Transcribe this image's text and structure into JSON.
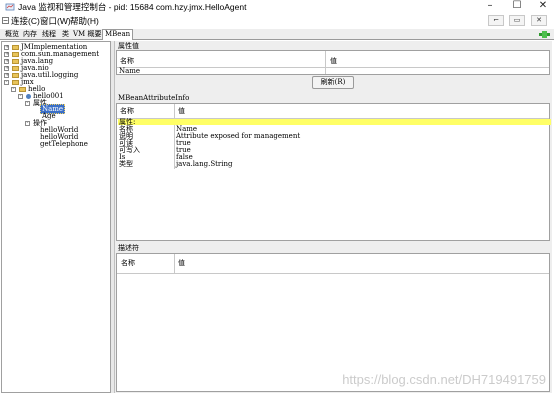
{
  "window": {
    "title": "Java 监视和管理控制台 - pid: 15684 com.hzy.jmx.HelloAgent",
    "controls": [
      "–",
      "☐",
      "✕"
    ]
  },
  "menubar": {
    "items": [
      "连接(C)",
      "窗口(W)",
      "帮助(H)"
    ],
    "inner_controls": [
      "⌐",
      "▭",
      "✕"
    ]
  },
  "tabs": [
    "概览",
    "内存",
    "线程",
    "类",
    "VM 概要",
    "MBean"
  ],
  "active_tab": "MBean",
  "tree": {
    "nodes": [
      {
        "label": "JMImplementation",
        "level": 0,
        "toggle": "+"
      },
      {
        "label": "com.sun.management",
        "level": 0,
        "toggle": "+"
      },
      {
        "label": "java.lang",
        "level": 0,
        "toggle": "+"
      },
      {
        "label": "java.nio",
        "level": 0,
        "toggle": "+"
      },
      {
        "label": "java.util.logging",
        "level": 0,
        "toggle": "+"
      },
      {
        "label": "jmx",
        "level": 0,
        "toggle": "-"
      },
      {
        "label": "hello",
        "level": 1,
        "toggle": "-"
      },
      {
        "label": "hello001",
        "level": 2,
        "toggle": "-"
      },
      {
        "label": "属性",
        "level": 3,
        "toggle": "-"
      },
      {
        "label": "Name",
        "level": 4,
        "toggle": ""
      },
      {
        "label": "Age",
        "level": 4,
        "toggle": ""
      },
      {
        "label": "操作",
        "level": 3,
        "toggle": "-"
      },
      {
        "label": "helloWorld",
        "level": 4,
        "toggle": ""
      },
      {
        "label": "helloWorld",
        "level": 4,
        "toggle": ""
      },
      {
        "label": "getTelephone",
        "level": 4,
        "toggle": ""
      }
    ],
    "selected_index": 9
  },
  "attr_values": {
    "section_label": "属性值",
    "col_name": "名称",
    "col_value": "值",
    "rows": [
      {
        "name": "Name",
        "value": ""
      }
    ],
    "refresh_button": "刷新(R)"
  },
  "mbean_info": {
    "section_label": "MBeanAttributeInfo",
    "col_name": "名称",
    "col_value": "值",
    "group_row": "属性:",
    "rows": [
      {
        "name": "名称",
        "value": "Name"
      },
      {
        "name": "说明",
        "value": "Attribute exposed for management"
      },
      {
        "name": "可读",
        "value": "true"
      },
      {
        "name": "可写入",
        "value": "true"
      },
      {
        "name": "Is",
        "value": "false"
      },
      {
        "name": "类型",
        "value": "java.lang.String"
      }
    ]
  },
  "descriptor": {
    "section_label": "描述符",
    "col_name": "名称",
    "col_value": "值"
  },
  "watermark": "https://blog.csdn.net/DH719491759"
}
